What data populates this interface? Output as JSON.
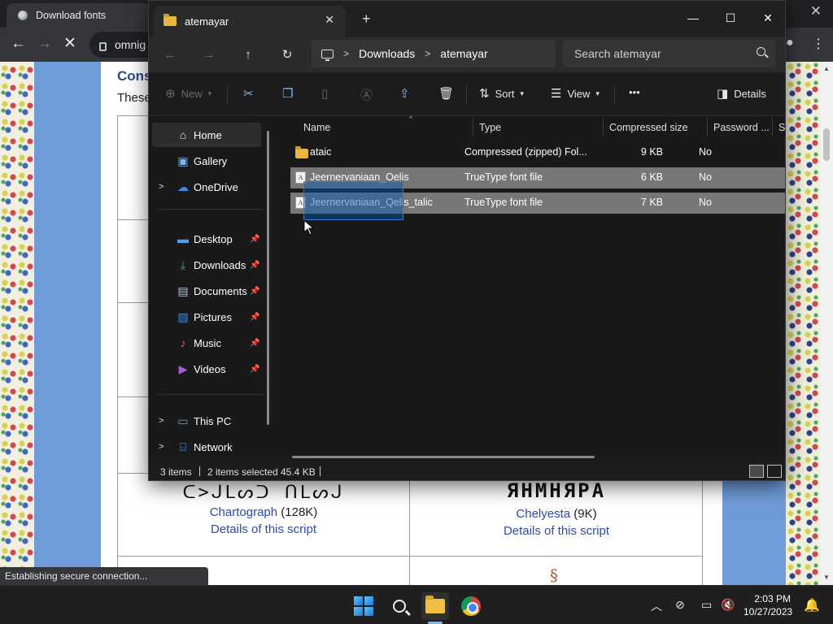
{
  "browser": {
    "tab_title": "Download fonts",
    "omnibox_text": "omnig",
    "window_close": "✕",
    "status_text": "Establishing secure connection..."
  },
  "webpage": {
    "heading": "Cons",
    "intro": "These",
    "fonts": [
      {
        "glyphs": "ᑕ>ᒍᒪᔕᑐ ᑎᒪᔕᒍ",
        "name": "Chartograph",
        "size": "(128K)",
        "details": "Details of this script"
      },
      {
        "glyphs": "ЯНМНЯРА",
        "name": "Chelyesta",
        "size": "(9K)",
        "details": "Details of this script"
      }
    ]
  },
  "explorer": {
    "tab_title": "atemayar",
    "search_placeholder": "Search atemayar",
    "breadcrumb": [
      "Downloads",
      "atemayar"
    ],
    "commands": {
      "new": "New",
      "sort": "Sort",
      "view": "View",
      "more": "•••",
      "details": "Details"
    },
    "nav": {
      "home": "Home",
      "gallery": "Gallery",
      "onedrive": "OneDrive",
      "desktop": "Desktop",
      "downloads": "Downloads",
      "documents": "Documents",
      "pictures": "Pictures",
      "music": "Music",
      "videos": "Videos",
      "this_pc": "This PC",
      "network": "Network"
    },
    "columns": {
      "name": "Name",
      "type": "Type",
      "compressed_size": "Compressed size",
      "password": "Password ...",
      "size": "Si"
    },
    "files": [
      {
        "name": "ataic",
        "type": "Compressed (zipped) Fol...",
        "size": "9 KB",
        "password": "No",
        "kind": "folder",
        "selected": false
      },
      {
        "name": "Jeernervaniaan_Oelis",
        "type": "TrueType font file",
        "size": "6 KB",
        "password": "No",
        "kind": "font",
        "selected": true
      },
      {
        "name": "Jeernervaniaan_Qelis_talic",
        "type": "TrueType font file",
        "size": "7 KB",
        "password": "No",
        "kind": "font",
        "selected": true
      }
    ],
    "status": {
      "items": "3 items",
      "selected": "2 items selected",
      "selected_size": "45.4 KB"
    }
  },
  "taskbar": {
    "time": "2:03 PM",
    "date": "10/27/2023"
  },
  "colors": {
    "explorer_bg": "#191919",
    "selection": "#777777",
    "accent": "#7ab4f5",
    "link": "#2a4ab8"
  }
}
